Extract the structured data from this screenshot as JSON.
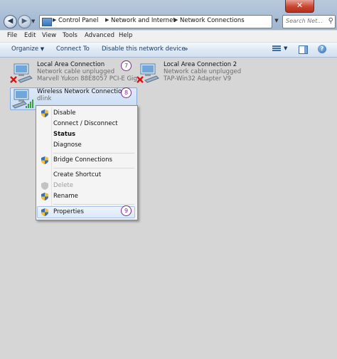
{
  "window": {
    "close_label": "✕",
    "address": {
      "crumbs": [
        "Control Panel",
        "Network and Internet",
        "Network Connections"
      ]
    },
    "search_placeholder": "Search Net..."
  },
  "menubar": [
    "File",
    "Edit",
    "View",
    "Tools",
    "Advanced",
    "Help"
  ],
  "commandbar": {
    "organize": "Organize",
    "connect_to": "Connect To",
    "disable": "Disable this network device",
    "more": "»"
  },
  "connections": [
    {
      "name": "Local Area Connection",
      "status": "Network cable unplugged",
      "device": "Marvell Yukon 88E8057 PCI-E Gig...",
      "badge": "7"
    },
    {
      "name": "Local Area Connection 2",
      "status": "Network cable unplugged",
      "device": "TAP-Win32 Adapter V9"
    },
    {
      "name": "Wireless Network Connection",
      "status": "dlink",
      "badge": "8"
    }
  ],
  "context_menu": {
    "items": [
      "Disable",
      "Connect / Disconnect",
      "Status",
      "Diagnose",
      "Bridge Connections",
      "Create Shortcut",
      "Delete",
      "Rename",
      "Properties"
    ],
    "properties_badge": "9"
  },
  "colors": {
    "accent": "#7b2a8c",
    "selection": "#c9dcf4"
  }
}
